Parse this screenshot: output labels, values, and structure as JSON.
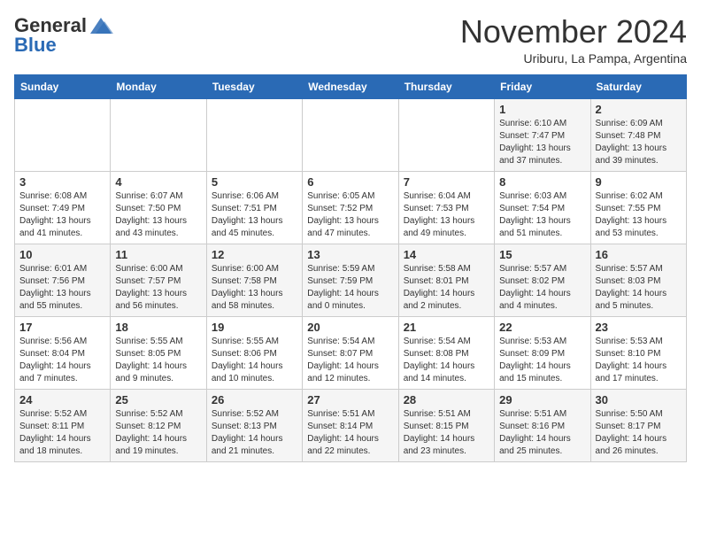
{
  "logo": {
    "general": "General",
    "blue": "Blue"
  },
  "title": "November 2024",
  "location": "Uriburu, La Pampa, Argentina",
  "weekdays": [
    "Sunday",
    "Monday",
    "Tuesday",
    "Wednesday",
    "Thursday",
    "Friday",
    "Saturday"
  ],
  "weeks": [
    [
      {
        "day": "",
        "info": ""
      },
      {
        "day": "",
        "info": ""
      },
      {
        "day": "",
        "info": ""
      },
      {
        "day": "",
        "info": ""
      },
      {
        "day": "",
        "info": ""
      },
      {
        "day": "1",
        "info": "Sunrise: 6:10 AM\nSunset: 7:47 PM\nDaylight: 13 hours\nand 37 minutes."
      },
      {
        "day": "2",
        "info": "Sunrise: 6:09 AM\nSunset: 7:48 PM\nDaylight: 13 hours\nand 39 minutes."
      }
    ],
    [
      {
        "day": "3",
        "info": "Sunrise: 6:08 AM\nSunset: 7:49 PM\nDaylight: 13 hours\nand 41 minutes."
      },
      {
        "day": "4",
        "info": "Sunrise: 6:07 AM\nSunset: 7:50 PM\nDaylight: 13 hours\nand 43 minutes."
      },
      {
        "day": "5",
        "info": "Sunrise: 6:06 AM\nSunset: 7:51 PM\nDaylight: 13 hours\nand 45 minutes."
      },
      {
        "day": "6",
        "info": "Sunrise: 6:05 AM\nSunset: 7:52 PM\nDaylight: 13 hours\nand 47 minutes."
      },
      {
        "day": "7",
        "info": "Sunrise: 6:04 AM\nSunset: 7:53 PM\nDaylight: 13 hours\nand 49 minutes."
      },
      {
        "day": "8",
        "info": "Sunrise: 6:03 AM\nSunset: 7:54 PM\nDaylight: 13 hours\nand 51 minutes."
      },
      {
        "day": "9",
        "info": "Sunrise: 6:02 AM\nSunset: 7:55 PM\nDaylight: 13 hours\nand 53 minutes."
      }
    ],
    [
      {
        "day": "10",
        "info": "Sunrise: 6:01 AM\nSunset: 7:56 PM\nDaylight: 13 hours\nand 55 minutes."
      },
      {
        "day": "11",
        "info": "Sunrise: 6:00 AM\nSunset: 7:57 PM\nDaylight: 13 hours\nand 56 minutes."
      },
      {
        "day": "12",
        "info": "Sunrise: 6:00 AM\nSunset: 7:58 PM\nDaylight: 13 hours\nand 58 minutes."
      },
      {
        "day": "13",
        "info": "Sunrise: 5:59 AM\nSunset: 7:59 PM\nDaylight: 14 hours\nand 0 minutes."
      },
      {
        "day": "14",
        "info": "Sunrise: 5:58 AM\nSunset: 8:01 PM\nDaylight: 14 hours\nand 2 minutes."
      },
      {
        "day": "15",
        "info": "Sunrise: 5:57 AM\nSunset: 8:02 PM\nDaylight: 14 hours\nand 4 minutes."
      },
      {
        "day": "16",
        "info": "Sunrise: 5:57 AM\nSunset: 8:03 PM\nDaylight: 14 hours\nand 5 minutes."
      }
    ],
    [
      {
        "day": "17",
        "info": "Sunrise: 5:56 AM\nSunset: 8:04 PM\nDaylight: 14 hours\nand 7 minutes."
      },
      {
        "day": "18",
        "info": "Sunrise: 5:55 AM\nSunset: 8:05 PM\nDaylight: 14 hours\nand 9 minutes."
      },
      {
        "day": "19",
        "info": "Sunrise: 5:55 AM\nSunset: 8:06 PM\nDaylight: 14 hours\nand 10 minutes."
      },
      {
        "day": "20",
        "info": "Sunrise: 5:54 AM\nSunset: 8:07 PM\nDaylight: 14 hours\nand 12 minutes."
      },
      {
        "day": "21",
        "info": "Sunrise: 5:54 AM\nSunset: 8:08 PM\nDaylight: 14 hours\nand 14 minutes."
      },
      {
        "day": "22",
        "info": "Sunrise: 5:53 AM\nSunset: 8:09 PM\nDaylight: 14 hours\nand 15 minutes."
      },
      {
        "day": "23",
        "info": "Sunrise: 5:53 AM\nSunset: 8:10 PM\nDaylight: 14 hours\nand 17 minutes."
      }
    ],
    [
      {
        "day": "24",
        "info": "Sunrise: 5:52 AM\nSunset: 8:11 PM\nDaylight: 14 hours\nand 18 minutes."
      },
      {
        "day": "25",
        "info": "Sunrise: 5:52 AM\nSunset: 8:12 PM\nDaylight: 14 hours\nand 19 minutes."
      },
      {
        "day": "26",
        "info": "Sunrise: 5:52 AM\nSunset: 8:13 PM\nDaylight: 14 hours\nand 21 minutes."
      },
      {
        "day": "27",
        "info": "Sunrise: 5:51 AM\nSunset: 8:14 PM\nDaylight: 14 hours\nand 22 minutes."
      },
      {
        "day": "28",
        "info": "Sunrise: 5:51 AM\nSunset: 8:15 PM\nDaylight: 14 hours\nand 23 minutes."
      },
      {
        "day": "29",
        "info": "Sunrise: 5:51 AM\nSunset: 8:16 PM\nDaylight: 14 hours\nand 25 minutes."
      },
      {
        "day": "30",
        "info": "Sunrise: 5:50 AM\nSunset: 8:17 PM\nDaylight: 14 hours\nand 26 minutes."
      }
    ]
  ]
}
